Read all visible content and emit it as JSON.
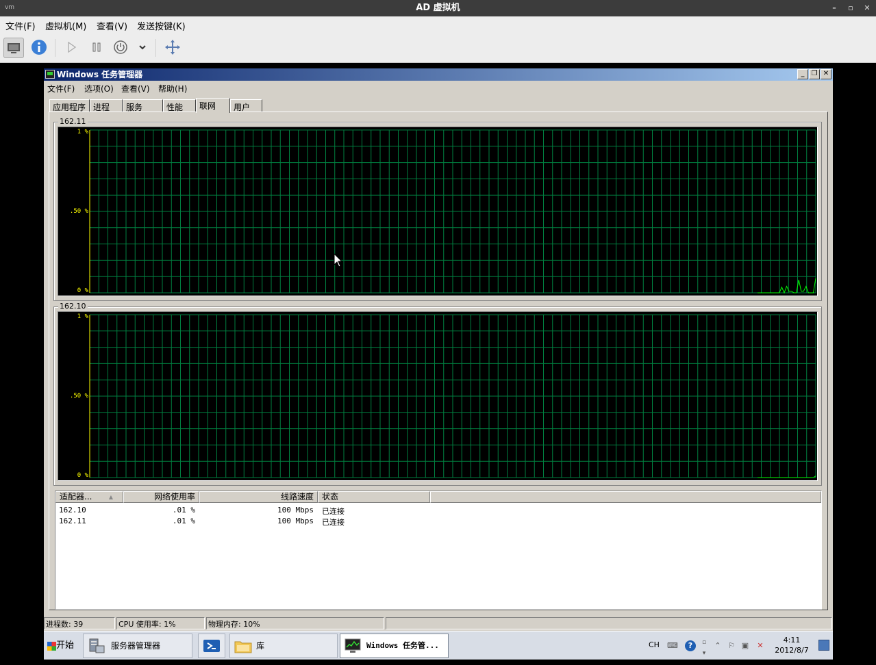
{
  "host": {
    "title": "AD 虚拟机",
    "app_icon_text": "vm",
    "menu": [
      "文件(F)",
      "虚拟机(M)",
      "查看(V)",
      "发送按键(K)"
    ]
  },
  "taskmgr": {
    "title": "Windows 任务管理器",
    "menu": [
      "文件(F)",
      "选项(O)",
      "查看(V)",
      "帮助(H)"
    ],
    "tabs": [
      "应用程序",
      "进程",
      "服务",
      "性能",
      "联网",
      "用户"
    ],
    "active_tab": 4,
    "graphs": [
      {
        "label": "162.11",
        "y_labels": [
          "1 %",
          ".50 %",
          "0 %"
        ]
      },
      {
        "label": "162.10",
        "y_labels": [
          "1 %",
          ".50 %",
          "0 %"
        ]
      }
    ],
    "list": {
      "columns": [
        "适配器...",
        "网络使用率",
        "线路速度",
        "状态"
      ],
      "rows": [
        {
          "adapter": "162.10",
          "usage": ".01 %",
          "speed": "100 Mbps",
          "status": "已连接"
        },
        {
          "adapter": "162.11",
          "usage": ".01 %",
          "speed": "100 Mbps",
          "status": "已连接"
        }
      ]
    },
    "status": {
      "processes": "进程数: 39",
      "cpu": "CPU 使用率: 1%",
      "memory": "物理内存: 10%"
    }
  },
  "taskbar": {
    "start": "开始",
    "tasks": [
      {
        "label": "服务器管理器"
      },
      {
        "label": ""
      },
      {
        "label": "库"
      },
      {
        "label": "Windows 任务管..."
      }
    ],
    "tray": {
      "lang": "CH",
      "time": "4:11",
      "date": "2012/8/7"
    }
  },
  "chart_data": [
    {
      "type": "line",
      "title": "162.11",
      "ylim": [
        0,
        1
      ],
      "y_unit": "%",
      "grid": true,
      "series": [
        {
          "values": [
            0,
            0,
            0,
            0,
            0,
            0,
            0,
            0,
            0,
            0,
            0.035,
            0,
            0.04,
            0.01,
            0.01,
            0,
            0,
            0.08,
            0.01,
            0.01,
            0.04,
            0,
            0,
            0,
            0.09
          ]
        }
      ]
    },
    {
      "type": "line",
      "title": "162.10",
      "ylim": [
        0,
        1
      ],
      "y_unit": "%",
      "grid": true,
      "series": [
        {
          "values": [
            0,
            0,
            0,
            0,
            0,
            0,
            0,
            0,
            0,
            0,
            0,
            0,
            0,
            0,
            0,
            0,
            0,
            0,
            0,
            0,
            0,
            0,
            0,
            0,
            0.01
          ]
        }
      ]
    }
  ]
}
